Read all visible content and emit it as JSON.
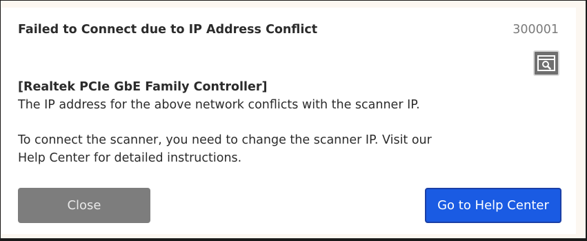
{
  "dialog": {
    "title": "Failed to Connect due to IP Address Conflict",
    "code": "300001",
    "adapter_name": "[Realtek PCIe GbE Family Controller]",
    "message_line1": "The IP address for the above network conflicts with the scanner IP.",
    "instruction_line1": "To connect the scanner, you need to change the scanner IP. Visit our",
    "instruction_line2": "Help Center for detailed instructions.",
    "close_label": "Close",
    "help_label": "Go to Help Center",
    "search_icon": "search-window-icon"
  },
  "colors": {
    "close_button": "#7d7d7d",
    "help_button": "#1a5be3",
    "icon_button": "#6f6f6f"
  }
}
